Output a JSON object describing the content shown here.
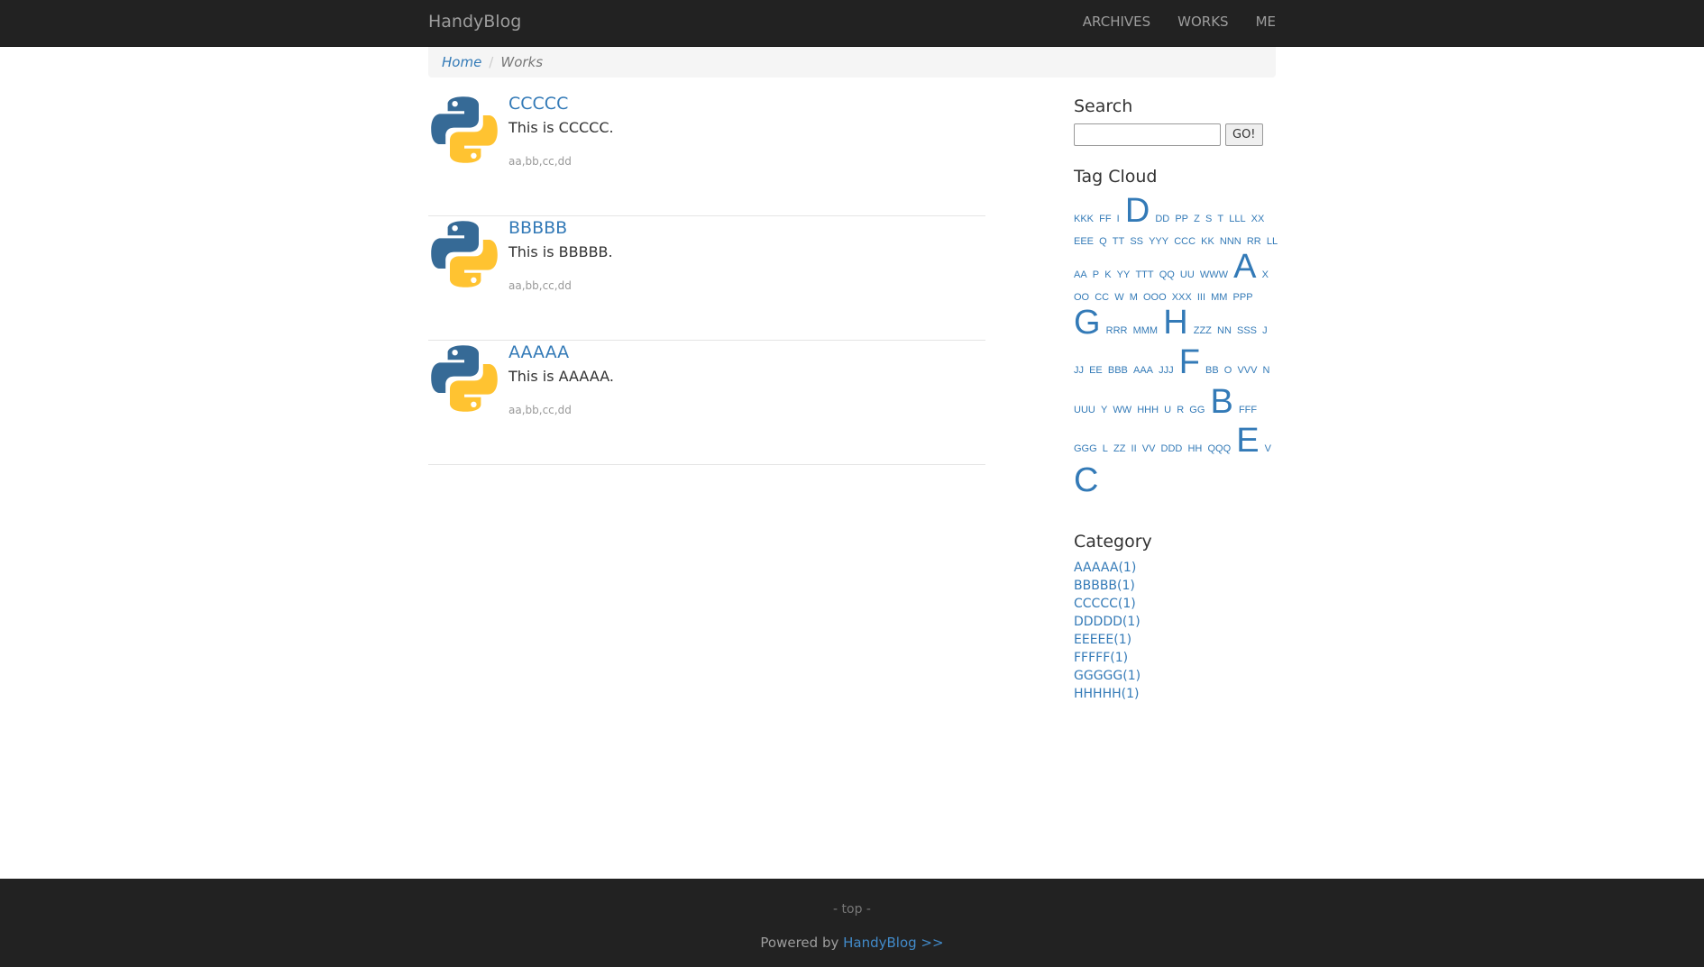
{
  "nav": {
    "brand": "HandyBlog",
    "links": [
      "ARCHIVES",
      "WORKS",
      "ME"
    ]
  },
  "breadcrumb": {
    "home": "Home",
    "sep": "/",
    "current": "Works"
  },
  "posts": [
    {
      "title": "CCCCC",
      "desc": "This is CCCCC.",
      "tags": "aa,bb,cc,dd",
      "icon": "python-logo-icon"
    },
    {
      "title": "BBBBB",
      "desc": "This is BBBBB.",
      "tags": "aa,bb,cc,dd",
      "icon": "python-logo-icon"
    },
    {
      "title": "AAAAA",
      "desc": "This is AAAAA.",
      "tags": "aa,bb,cc,dd",
      "icon": "python-logo-icon"
    }
  ],
  "search": {
    "title": "Search",
    "value": "",
    "button": "GO!"
  },
  "tagcloud": {
    "title": "Tag Cloud",
    "tags": [
      {
        "t": "KKK",
        "s": "s"
      },
      {
        "t": "FF",
        "s": "s"
      },
      {
        "t": "I",
        "s": "s"
      },
      {
        "t": "D",
        "s": "xl"
      },
      {
        "t": "DD",
        "s": "s"
      },
      {
        "t": "PP",
        "s": "s"
      },
      {
        "t": "Z",
        "s": "s"
      },
      {
        "t": "S",
        "s": "s"
      },
      {
        "t": "T",
        "s": "s"
      },
      {
        "t": "LLL",
        "s": "s"
      },
      {
        "t": "XX",
        "s": "s"
      },
      {
        "t": "EEE",
        "s": "s"
      },
      {
        "t": "Q",
        "s": "s"
      },
      {
        "t": "TT",
        "s": "s"
      },
      {
        "t": "SS",
        "s": "s"
      },
      {
        "t": "YYY",
        "s": "s"
      },
      {
        "t": "CCC",
        "s": "s"
      },
      {
        "t": "KK",
        "s": "s"
      },
      {
        "t": "NNN",
        "s": "s"
      },
      {
        "t": "RR",
        "s": "s"
      },
      {
        "t": "LL",
        "s": "s"
      },
      {
        "t": "AA",
        "s": "s"
      },
      {
        "t": "P",
        "s": "s"
      },
      {
        "t": "K",
        "s": "s"
      },
      {
        "t": "YY",
        "s": "s"
      },
      {
        "t": "TTT",
        "s": "s"
      },
      {
        "t": "QQ",
        "s": "s"
      },
      {
        "t": "UU",
        "s": "s"
      },
      {
        "t": "WWW",
        "s": "s"
      },
      {
        "t": "A",
        "s": "xl"
      },
      {
        "t": "X",
        "s": "s"
      },
      {
        "t": "OO",
        "s": "s"
      },
      {
        "t": "CC",
        "s": "s"
      },
      {
        "t": "W",
        "s": "s"
      },
      {
        "t": "M",
        "s": "s"
      },
      {
        "t": "OOO",
        "s": "s"
      },
      {
        "t": "XXX",
        "s": "s"
      },
      {
        "t": "III",
        "s": "s"
      },
      {
        "t": "MM",
        "s": "s"
      },
      {
        "t": "PPP",
        "s": "s"
      },
      {
        "t": "G",
        "s": "xl"
      },
      {
        "t": "RRR",
        "s": "s"
      },
      {
        "t": "MMM",
        "s": "s"
      },
      {
        "t": "H",
        "s": "xl"
      },
      {
        "t": "ZZZ",
        "s": "s"
      },
      {
        "t": "NN",
        "s": "s"
      },
      {
        "t": "SSS",
        "s": "s"
      },
      {
        "t": "J",
        "s": "s"
      },
      {
        "t": "JJ",
        "s": "s"
      },
      {
        "t": "EE",
        "s": "s"
      },
      {
        "t": "BBB",
        "s": "s"
      },
      {
        "t": "AAA",
        "s": "s"
      },
      {
        "t": "JJJ",
        "s": "s"
      },
      {
        "t": "F",
        "s": "xl"
      },
      {
        "t": "BB",
        "s": "s"
      },
      {
        "t": "O",
        "s": "s"
      },
      {
        "t": "VVV",
        "s": "s"
      },
      {
        "t": "N",
        "s": "s"
      },
      {
        "t": "UUU",
        "s": "s"
      },
      {
        "t": "Y",
        "s": "s"
      },
      {
        "t": "WW",
        "s": "s"
      },
      {
        "t": "HHH",
        "s": "s"
      },
      {
        "t": "U",
        "s": "s"
      },
      {
        "t": "R",
        "s": "s"
      },
      {
        "t": "GG",
        "s": "s"
      },
      {
        "t": "B",
        "s": "xl"
      },
      {
        "t": "FFF",
        "s": "s"
      },
      {
        "t": "GGG",
        "s": "s"
      },
      {
        "t": "L",
        "s": "s"
      },
      {
        "t": "ZZ",
        "s": "s"
      },
      {
        "t": "II",
        "s": "s"
      },
      {
        "t": "VV",
        "s": "s"
      },
      {
        "t": "DDD",
        "s": "s"
      },
      {
        "t": "HH",
        "s": "s"
      },
      {
        "t": "QQQ",
        "s": "s"
      },
      {
        "t": "E",
        "s": "xl"
      },
      {
        "t": "V",
        "s": "s"
      },
      {
        "t": "C",
        "s": "xl"
      }
    ]
  },
  "category": {
    "title": "Category",
    "items": [
      "AAAAA(1)",
      "BBBBB(1)",
      "CCCCC(1)",
      "DDDDD(1)",
      "EEEEE(1)",
      "FFFFF(1)",
      "GGGGG(1)",
      "HHHHH(1)"
    ]
  },
  "footer": {
    "top": "- top -",
    "powered_prefix": "Powered by ",
    "powered_link": "HandyBlog >>"
  },
  "colors": {
    "nav_bg": "#222222",
    "link": "#337ab7",
    "python_blue": "#366a96",
    "python_yellow": "#ffc331"
  }
}
